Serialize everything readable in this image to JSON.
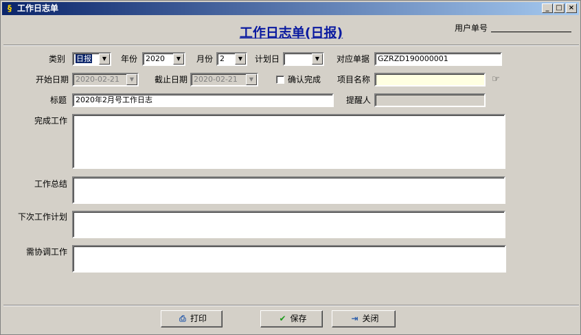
{
  "window": {
    "title": "工作日志单"
  },
  "header": {
    "heading": "工作日志单(日报)",
    "user_no_label": "用户单号"
  },
  "row1": {
    "category_label": "类别",
    "category_value": "日报",
    "year_label": "年份",
    "year_value": "2020",
    "month_label": "月份",
    "month_value": "2",
    "plan_day_label": "计划日",
    "plan_day_value": "",
    "ref_no_label": "对应单据",
    "ref_no_value": "GZRZD190000001"
  },
  "row2": {
    "start_date_label": "开始日期",
    "start_date_value": "2020-02-21",
    "end_date_label": "截止日期",
    "end_date_value": "2020-02-21",
    "confirm_label": "确认完成",
    "project_label": "项目名称",
    "project_value": ""
  },
  "row3": {
    "title_label": "标题",
    "title_value": "2020年2月号工作日志",
    "reminder_label": "提醒人",
    "reminder_value": ""
  },
  "memos": {
    "completed_label": "完成工作",
    "summary_label": "工作总结",
    "next_plan_label": "下次工作计划",
    "coordination_label": "需协调工作"
  },
  "footer": {
    "print_label": "打印",
    "save_label": "保存",
    "close_label": "关闭"
  },
  "colors": {
    "titlebar_start": "#0a246a",
    "heading": "#0a1aa0",
    "face": "#d4d0c8",
    "project_field": "#ffffe1"
  },
  "icons": [
    "app-icon",
    "minimize-icon",
    "maximize-icon",
    "close-icon",
    "dropdown-arrow-icon",
    "lookup-icon",
    "printer-icon",
    "checkmark-icon",
    "exit-icon"
  ]
}
